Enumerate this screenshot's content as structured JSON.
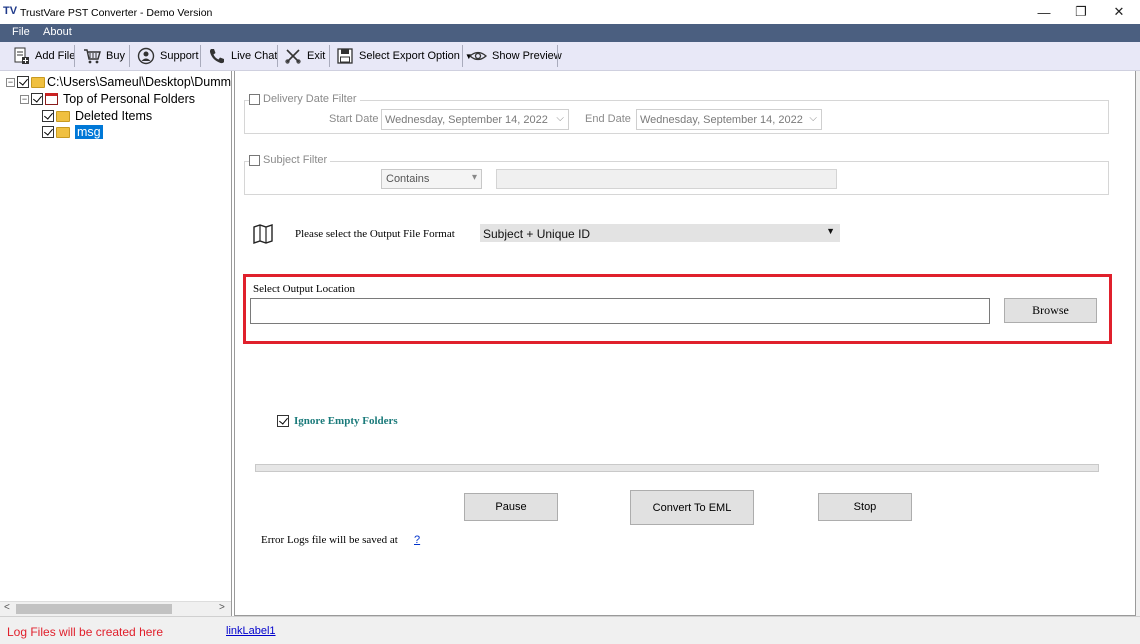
{
  "window": {
    "app_icon": "TV",
    "title": "TrustVare PST Converter - Demo Version",
    "minimize_glyph": "—",
    "maximize_glyph": "❐",
    "close_glyph": "✕"
  },
  "menu": {
    "items": [
      "File",
      "About"
    ]
  },
  "toolbar": {
    "items": [
      {
        "label": "Add File",
        "icon": "add-file-icon"
      },
      {
        "label": "Buy",
        "icon": "cart-icon"
      },
      {
        "label": "Support",
        "icon": "support-icon"
      },
      {
        "label": "Live Chat",
        "icon": "phone-icon"
      },
      {
        "label": "Exit",
        "icon": "exit-icon"
      },
      {
        "label": "Select Export Option",
        "icon": "save-icon",
        "has_dropdown": true
      },
      {
        "label": "Show Preview",
        "icon": "eye-icon"
      }
    ]
  },
  "tree": {
    "root": "C:\\Users\\Sameul\\Desktop\\Dummy",
    "level1": "Top of Personal Folders",
    "children": [
      "Deleted Items",
      "msg"
    ],
    "selected": "msg"
  },
  "filters": {
    "delivery": {
      "label": "Delivery Date Filter",
      "start_label": "Start Date",
      "start_value": "Wednesday, September 14, 2022",
      "end_label": "End Date",
      "end_value": "Wednesday, September 14, 2022"
    },
    "subject": {
      "label": "Subject Filter",
      "operator": "Contains",
      "value": ""
    }
  },
  "format": {
    "label": "Please select the Output File Format",
    "value": "Subject + Unique ID"
  },
  "output": {
    "label": "Select Output Location",
    "value": "",
    "browse_label": "Browse"
  },
  "options": {
    "ignore_empty_folders": "Ignore Empty Folders",
    "ignore_empty_checked": true
  },
  "progress": {
    "value": 0
  },
  "actions": {
    "pause": "Pause",
    "convert": "Convert To EML",
    "stop": "Stop"
  },
  "error_logs": {
    "label": "Error Logs file will be saved at",
    "link": "?"
  },
  "statusbar": {
    "text": "Log Files will be created here",
    "link": "linkLabel1"
  },
  "colors": {
    "menubar": "#4b5f80",
    "toolbar": "#e8e8f7",
    "highlight_border": "#e0202c",
    "selection": "#0078d7"
  }
}
